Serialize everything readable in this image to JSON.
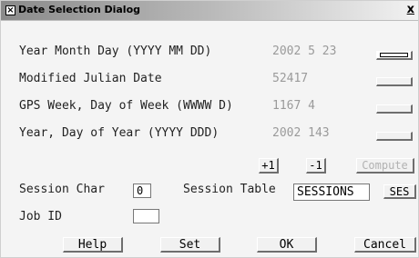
{
  "window": {
    "title": "Date Selection Dialog",
    "close_glyph": "x"
  },
  "rows": [
    {
      "label": "Year Month Day (YYYY MM DD)",
      "value": "2002 5 23"
    },
    {
      "label": "Modified Julian Date",
      "value": "52417"
    },
    {
      "label": "GPS Week, Day of Week (WWWW D)",
      "value": "1167 4"
    },
    {
      "label": "Year, Day of Year (YYYY DDD)",
      "value": "2002 143"
    }
  ],
  "step": {
    "plus_label": "+1",
    "minus_label": "-1",
    "compute_label": "Compute"
  },
  "session": {
    "char_label": "Session Char",
    "char_value": "0",
    "table_label": "Session Table",
    "table_value": "SESSIONS",
    "ses_button": "SES"
  },
  "job": {
    "label": "Job ID",
    "value": ""
  },
  "actions": {
    "help": "Help",
    "set": "Set",
    "ok": "OK",
    "cancel": "Cancel"
  }
}
